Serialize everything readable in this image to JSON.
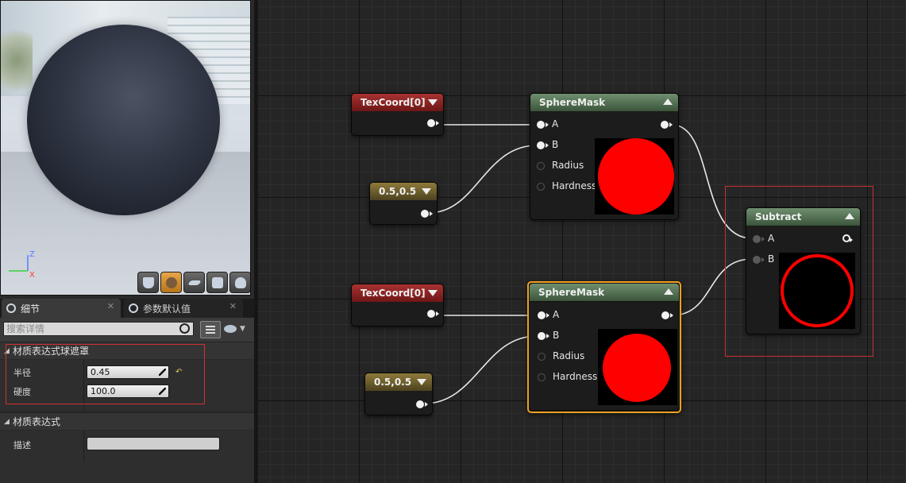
{
  "viewport": {
    "axis": {
      "z": "Z",
      "x": "X"
    },
    "toolbar_icons": [
      "cylinder-icon",
      "sphere-icon",
      "plane-icon",
      "cube-icon",
      "teapot-icon"
    ],
    "active_tool": "sphere-icon"
  },
  "tabs": [
    {
      "label": "细节",
      "icon": "details-icon",
      "close": "✕"
    },
    {
      "label": "参数默认值",
      "icon": "parameter-icon",
      "close": "✕"
    }
  ],
  "search": {
    "placeholder": "搜索详情"
  },
  "sections": [
    {
      "title": "材质表达式球遮罩",
      "properties": [
        {
          "label": "半径",
          "value": "0.45"
        },
        {
          "label": "硬度",
          "value": "100.0"
        }
      ]
    },
    {
      "title": "材质表达式",
      "properties": [
        {
          "label": "描述",
          "value": ""
        }
      ]
    }
  ],
  "graph": {
    "nodes": {
      "texcoord1": {
        "title": "TexCoord[0]"
      },
      "const1": {
        "title": "0.5,0.5"
      },
      "spheremask1": {
        "title": "SphereMask",
        "pins": [
          "A",
          "B",
          "Radius",
          "Hardness"
        ]
      },
      "texcoord2": {
        "title": "TexCoord[0]"
      },
      "const2": {
        "title": "0.5,0.5"
      },
      "spheremask2": {
        "title": "SphereMask",
        "pins": [
          "A",
          "B",
          "Radius",
          "Hardness"
        ]
      },
      "subtract": {
        "title": "Subtract",
        "pins": [
          "A",
          "B"
        ]
      }
    }
  },
  "colors": {
    "texcoord_header": "#8e2a2a",
    "constant_header": "#7a6a32",
    "math_header": "#5a7a5a",
    "selection_outline": "#f0a020",
    "comment_box": "#c83232",
    "preview_red": "#ff0000"
  }
}
